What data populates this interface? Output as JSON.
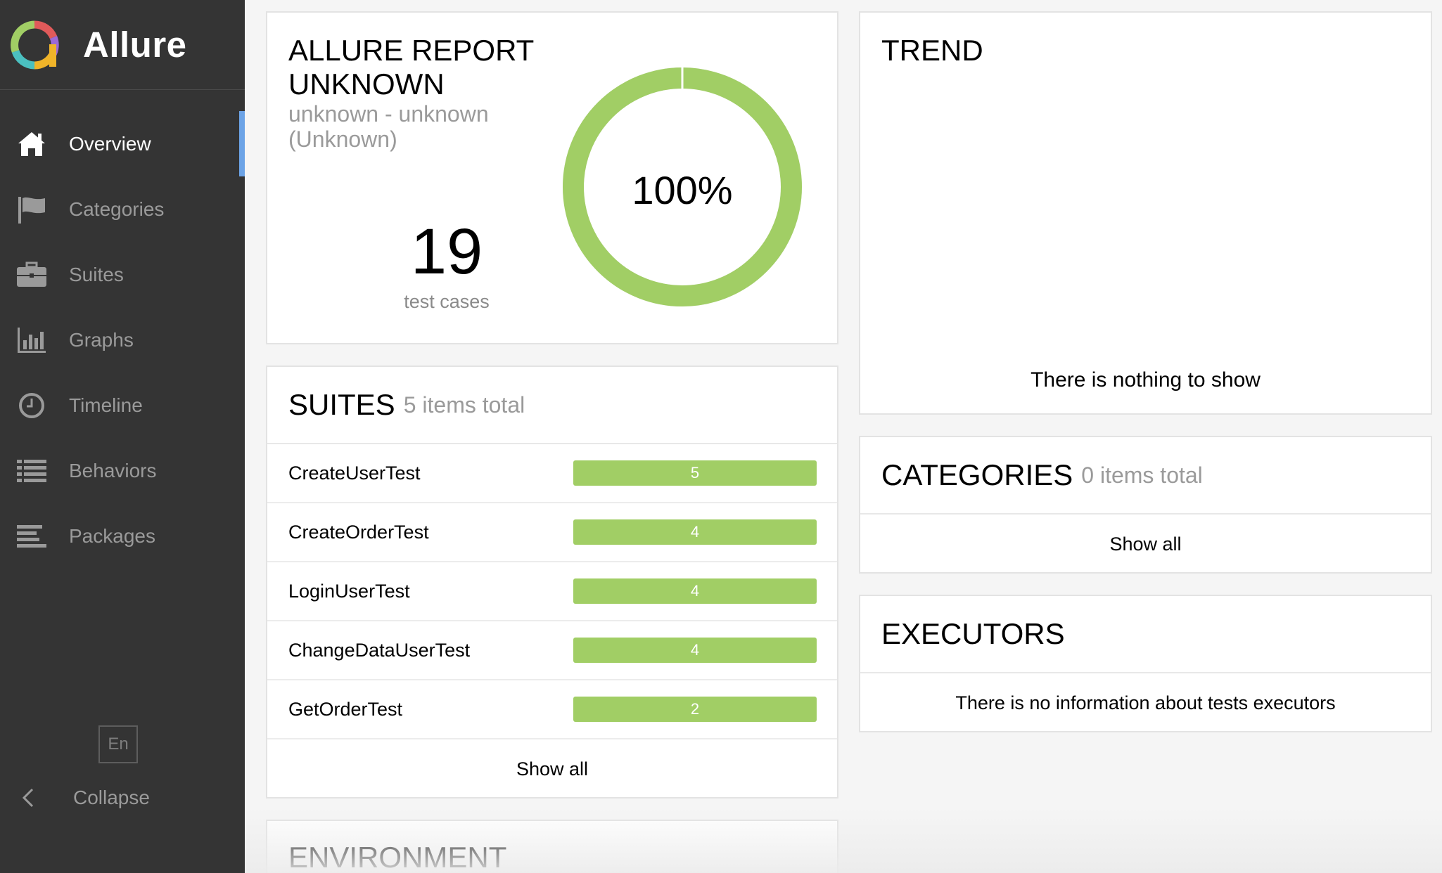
{
  "app": {
    "name": "Allure",
    "logo_colors": [
      "#e05a5a",
      "#9c6ad6",
      "#f0b429",
      "#4bc0c0",
      "#a1ce65"
    ]
  },
  "sidebar": {
    "items": [
      {
        "label": "Overview",
        "icon": "home-icon",
        "active": true
      },
      {
        "label": "Categories",
        "icon": "flag-icon",
        "active": false
      },
      {
        "label": "Suites",
        "icon": "briefcase-icon",
        "active": false
      },
      {
        "label": "Graphs",
        "icon": "bar-chart-icon",
        "active": false
      },
      {
        "label": "Timeline",
        "icon": "clock-icon",
        "active": false
      },
      {
        "label": "Behaviors",
        "icon": "list-icon",
        "active": false
      },
      {
        "label": "Packages",
        "icon": "align-left-icon",
        "active": false
      }
    ],
    "language": "En",
    "collapse_label": "Collapse",
    "active_color": "#6ca3e6"
  },
  "summary": {
    "title": "ALLURE REPORT UNKNOWN",
    "dates": "unknown - unknown (Unknown)",
    "test_count": "19",
    "test_count_label": "test cases",
    "percent_label": "100%",
    "passed_fraction": 1.0,
    "passed_color": "#a1ce65"
  },
  "suites": {
    "title": "SUITES",
    "subtitle": "5 items total",
    "rows": [
      {
        "name": "CreateUserTest",
        "count": "5"
      },
      {
        "name": "CreateOrderTest",
        "count": "4"
      },
      {
        "name": "LoginUserTest",
        "count": "4"
      },
      {
        "name": "ChangeDataUserTest",
        "count": "4"
      },
      {
        "name": "GetOrderTest",
        "count": "2"
      }
    ],
    "show_all": "Show all"
  },
  "environment": {
    "title": "ENVIRONMENT"
  },
  "trend": {
    "title": "TREND",
    "empty_message": "There is nothing to show"
  },
  "categories": {
    "title": "CATEGORIES",
    "subtitle": "0 items total",
    "show_all": "Show all"
  },
  "executors": {
    "title": "EXECUTORS",
    "empty_message": "There is no information about tests executors"
  }
}
